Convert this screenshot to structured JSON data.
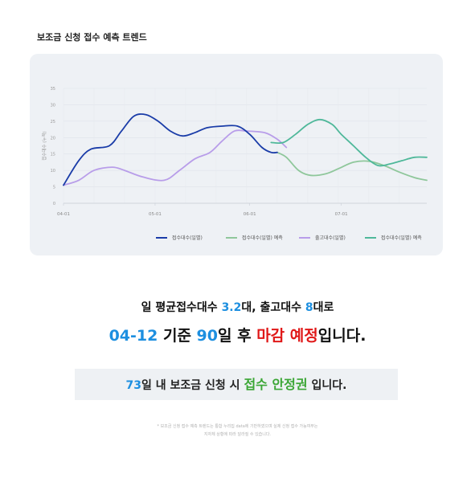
{
  "page_title": "보조금 신청 접수 예측 트렌드",
  "chart_data": {
    "type": "line",
    "ylabel": "접수대수 (누적)",
    "ylim": [
      0,
      35
    ],
    "yticks": [
      0,
      5,
      10,
      15,
      20,
      25,
      30,
      35
    ],
    "x_tick_labels": [
      "04-01",
      "05-01",
      "06-01",
      "07-01"
    ],
    "grid": true,
    "legend_position": "bottom",
    "series": [
      {
        "name": "접수대수(일별)",
        "color": "#1a3ca8",
        "points": [
          [
            0,
            5.5
          ],
          [
            5,
            13
          ],
          [
            9,
            16.5
          ],
          [
            15,
            17.5
          ],
          [
            19,
            22
          ],
          [
            23,
            26.5
          ],
          [
            27,
            27
          ],
          [
            31,
            25
          ],
          [
            35,
            22
          ],
          [
            39,
            20.5
          ],
          [
            43,
            21.5
          ],
          [
            47,
            23
          ],
          [
            52,
            23.5
          ],
          [
            57,
            23.5
          ],
          [
            61,
            21
          ],
          [
            65,
            17
          ],
          [
            68,
            15.5
          ],
          [
            70,
            15.5
          ]
        ]
      },
      {
        "name": "접수대수(일별) 예측",
        "color": "#8fc79b",
        "points": [
          [
            70,
            15.5
          ],
          [
            73,
            14
          ],
          [
            77,
            10
          ],
          [
            81,
            8.5
          ],
          [
            86,
            9
          ],
          [
            90,
            10.5
          ],
          [
            95,
            12.5
          ],
          [
            100,
            12.8
          ],
          [
            105,
            11.5
          ],
          [
            110,
            9.5
          ],
          [
            115,
            7.8
          ],
          [
            119,
            7
          ]
        ]
      },
      {
        "name": "출고대수(일별)",
        "color": "#b89de9",
        "points": [
          [
            0,
            5.5
          ],
          [
            5,
            7
          ],
          [
            10,
            10
          ],
          [
            16,
            11
          ],
          [
            20,
            10
          ],
          [
            26,
            8
          ],
          [
            33,
            7
          ],
          [
            38,
            10
          ],
          [
            43,
            13.5
          ],
          [
            48,
            15.5
          ],
          [
            52,
            19
          ],
          [
            56,
            22
          ],
          [
            60,
            22
          ],
          [
            66,
            21.5
          ],
          [
            70,
            19.5
          ],
          [
            73,
            17
          ]
        ]
      },
      {
        "name": "접수대수(일별) 예측",
        "color": "#4fb89a",
        "points": [
          [
            68,
            18.5
          ],
          [
            72,
            18.5
          ],
          [
            76,
            21
          ],
          [
            80,
            24
          ],
          [
            84,
            25.5
          ],
          [
            88,
            24
          ],
          [
            91,
            21
          ],
          [
            95,
            17.5
          ],
          [
            99,
            14
          ],
          [
            103,
            11.5
          ],
          [
            107,
            12
          ],
          [
            111,
            13
          ],
          [
            115,
            14
          ],
          [
            119,
            14
          ]
        ]
      }
    ]
  },
  "summary": {
    "line1_pre": "일 평균접수대수 ",
    "line1_value1": "3.2",
    "line1_mid": "대, 출고대수 ",
    "line1_value2": "8",
    "line1_post": "대로",
    "line2_date": "04-12",
    "line2_mid": " 기준 ",
    "line2_days": "90",
    "line2_mid2": "일 후 ",
    "line2_deadline": "마감 예정",
    "line2_post": "입니다."
  },
  "notice": {
    "days": "73",
    "pre": "일 내 보조금 신청 시 ",
    "highlight": "접수 안정권",
    "post": " 입니다."
  },
  "footnote": {
    "line1": "* 보조금 신청 접수 예측 트렌드는 통합 누리집 data에 기반하였으며 실제 신청 접수 가능여부는",
    "line2": "지자체 상황에 따라 달라질 수 있습니다."
  }
}
